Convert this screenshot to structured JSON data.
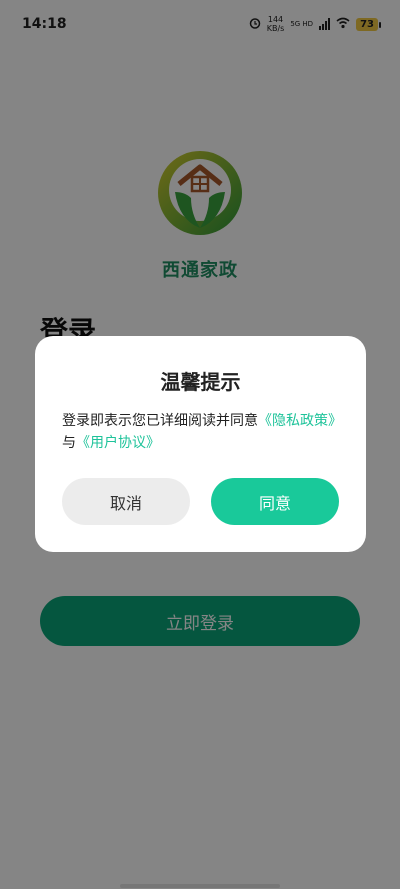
{
  "status_bar": {
    "time": "14:18",
    "net_speed_value": "144",
    "net_speed_unit": "KB/s",
    "network": "5G HD",
    "battery": "73",
    "icons": [
      "alarm-icon",
      "signal-icon",
      "wifi-icon",
      "battery-icon"
    ]
  },
  "brand": {
    "name": "西通家政"
  },
  "login": {
    "title": "登录",
    "button_label": "立即登录"
  },
  "dialog": {
    "title": "温馨提示",
    "message_prefix": "登录即表示您已详细阅读并同意",
    "privacy_link": "《隐私政策》",
    "conjunction": "与",
    "agreement_link": "《用户协议》",
    "cancel_label": "取消",
    "agree_label": "同意"
  },
  "colors": {
    "accent": "#19c99a",
    "brand": "#1f8e62",
    "login_button": "#0aa57a"
  }
}
